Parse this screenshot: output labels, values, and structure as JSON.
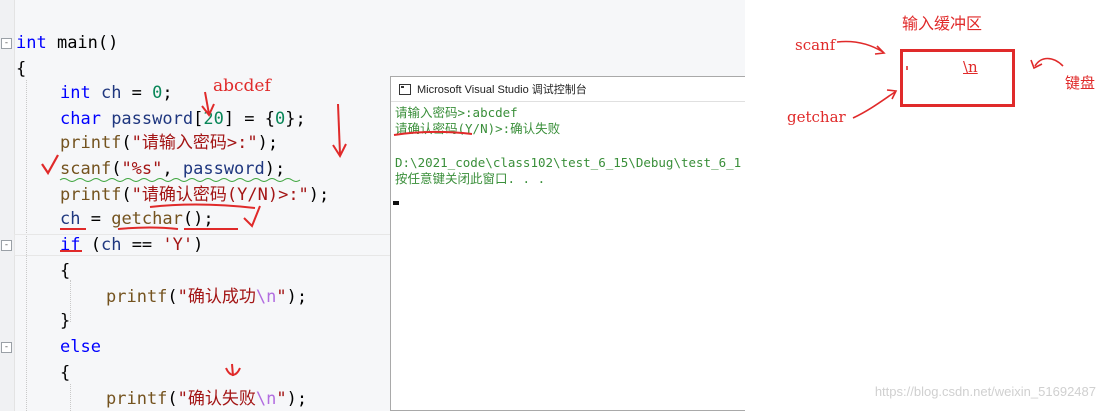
{
  "editor": {
    "lines": [
      {
        "id": "l1",
        "parts": [
          [
            "kw",
            "int"
          ],
          [
            "pun",
            " main()"
          ]
        ]
      },
      {
        "id": "l2",
        "parts": [
          [
            "pun",
            "{"
          ]
        ]
      },
      {
        "id": "l3",
        "parts": [
          [
            "kw",
            "int"
          ],
          [
            "var",
            " ch "
          ],
          [
            "pun",
            "= "
          ],
          [
            "num",
            "0"
          ],
          [
            "pun",
            ";"
          ]
        ]
      },
      {
        "id": "l4",
        "parts": [
          [
            "kw",
            "char"
          ],
          [
            "var",
            " password"
          ],
          [
            "pun",
            "["
          ],
          [
            "num",
            "20"
          ],
          [
            "pun",
            "] = {"
          ],
          [
            "num",
            "0"
          ],
          [
            "pun",
            "};"
          ]
        ]
      },
      {
        "id": "l5",
        "parts": [
          [
            "fn",
            "printf"
          ],
          [
            "pun",
            "("
          ],
          [
            "str",
            "\"请输入密码>:\""
          ],
          [
            "pun",
            ");"
          ]
        ]
      },
      {
        "id": "l6",
        "parts": [
          [
            "fn",
            "scanf"
          ],
          [
            "pun",
            "("
          ],
          [
            "str",
            "\"%s\""
          ],
          [
            "pun",
            ", "
          ],
          [
            "var",
            "password"
          ],
          [
            "pun",
            ");"
          ]
        ]
      },
      {
        "id": "l7",
        "parts": [
          [
            "fn",
            "printf"
          ],
          [
            "pun",
            "("
          ],
          [
            "str",
            "\"请确认密码(Y/N)>:\""
          ],
          [
            "pun",
            ");"
          ]
        ]
      },
      {
        "id": "l8",
        "parts": [
          [
            "var",
            "ch"
          ],
          [
            "pun",
            " = "
          ],
          [
            "fn",
            "getchar"
          ],
          [
            "pun",
            "();"
          ]
        ]
      },
      {
        "id": "l9",
        "parts": [
          [
            "kw",
            "if"
          ],
          [
            "pun",
            " ("
          ],
          [
            "var",
            "ch"
          ],
          [
            "pun",
            " == "
          ],
          [
            "str",
            "'Y'"
          ],
          [
            "pun",
            ")"
          ]
        ]
      },
      {
        "id": "l10",
        "parts": [
          [
            "pun",
            "{"
          ]
        ]
      },
      {
        "id": "l11",
        "parts": [
          [
            "fn",
            "printf"
          ],
          [
            "pun",
            "("
          ],
          [
            "str",
            "\"确认成功"
          ],
          [
            "esc",
            "\\n"
          ],
          [
            "str",
            "\""
          ],
          [
            "pun",
            ");"
          ]
        ]
      },
      {
        "id": "l12",
        "parts": [
          [
            "pun",
            "}"
          ]
        ]
      },
      {
        "id": "l13",
        "parts": [
          [
            "kw",
            "else"
          ]
        ]
      },
      {
        "id": "l14",
        "parts": [
          [
            "pun",
            "{"
          ]
        ]
      },
      {
        "id": "l15",
        "parts": [
          [
            "fn",
            "printf"
          ],
          [
            "pun",
            "("
          ],
          [
            "str",
            "\"确认失败"
          ],
          [
            "esc",
            "\\n"
          ],
          [
            "str",
            "\""
          ],
          [
            "pun",
            ");"
          ]
        ]
      }
    ],
    "annotation_input": "abcdef"
  },
  "console": {
    "title": "Microsoft Visual Studio 调试控制台",
    "lines": [
      "请输入密码>:abcdef",
      "请确认密码(Y/N)>:确认失败",
      "",
      "D:\\2021_code\\class102\\test_6_15\\Debug\\test_6_1",
      "按任意键关闭此窗口. . ."
    ]
  },
  "diagram": {
    "heading": "输入缓冲区",
    "scanf_label": "scanf",
    "getchar_label": "getchar",
    "keyboard_label": "键盘",
    "buffer_content": "\\n"
  },
  "watermark": "https://blog.csdn.net/weixin_51692487",
  "colors": {
    "ink": "#e02a2a",
    "keyword": "#0000ff",
    "string": "#a31515",
    "console_text": "#3a8f3a"
  }
}
